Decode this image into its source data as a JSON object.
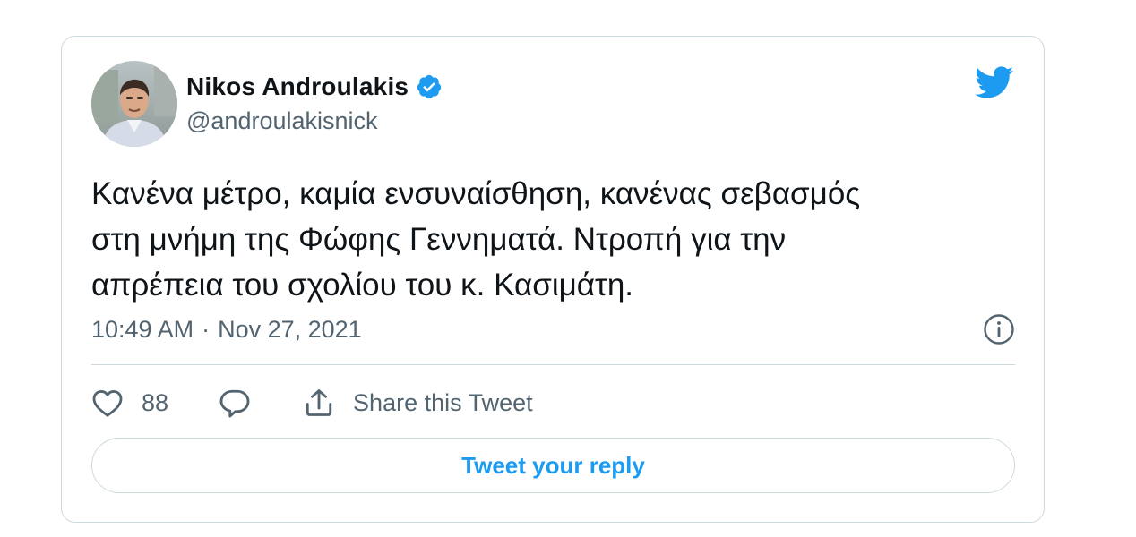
{
  "user": {
    "name": "Nikos Androulakis",
    "handle": "@androulakisnick",
    "verified": true,
    "avatar_icon": "profile-photo"
  },
  "tweet": {
    "text": "Κανένα μέτρο, καμία ενσυναίσθηση, κανένας σεβασμός\nστη μνήμη της Φώφης Γεννηματά. Ντροπή για την\nαπρέπεια του σχολίου του κ. Κασιμάτη.",
    "time": "10:49 AM",
    "separator": "·",
    "date": "Nov 27, 2021"
  },
  "actions": {
    "like_count": "88",
    "share_label": "Share this Tweet"
  },
  "reply_button": {
    "label": "Tweet your reply"
  },
  "colors": {
    "brand": "#1d9bf0",
    "text": "#0f1419",
    "secondary": "#536471",
    "border": "#cfd9de"
  }
}
